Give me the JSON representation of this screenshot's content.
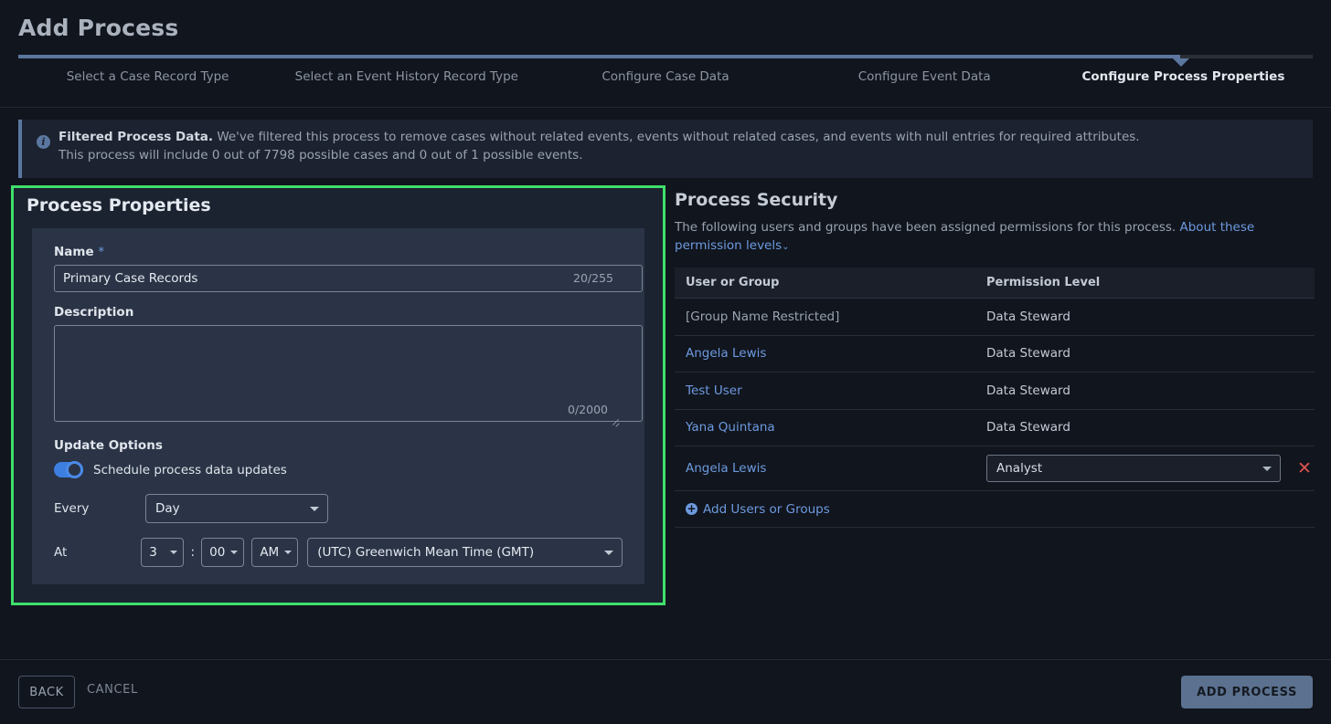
{
  "header": {
    "title": "Add Process",
    "steps": [
      {
        "label": "Select a Case Record Type",
        "active": false
      },
      {
        "label": "Select an Event History Record Type",
        "active": false
      },
      {
        "label": "Configure Case Data",
        "active": false
      },
      {
        "label": "Configure Event Data",
        "active": false
      },
      {
        "label": "Configure Process Properties",
        "active": true
      }
    ],
    "progress_percent": 90
  },
  "banner": {
    "icon": "info-icon",
    "strong": "Filtered Process Data.",
    "line1": " We've filtered this process to remove cases without related events, events without related cases, and events with null entries for required attributes.",
    "line2": "This process will include 0 out of 7798 possible cases and 0 out of 1 possible events."
  },
  "process_properties": {
    "panel_title": "Process Properties",
    "highlight_color": "#3ee06b",
    "name_label": "Name",
    "required_mark": "*",
    "name_value": "Primary Case Records",
    "name_counter": "20/255",
    "description_label": "Description",
    "description_value": "",
    "description_counter": "0/2000",
    "update_options_label": "Update Options",
    "schedule_toggle_label": "Schedule process data updates",
    "schedule_toggle_on": true,
    "every_label": "Every",
    "every_value": "Day",
    "at_label": "At",
    "hour_value": "3",
    "colon": ":",
    "minute_value": "00",
    "ampm_value": "AM",
    "timezone_value": "(UTC) Greenwich Mean Time (GMT)"
  },
  "process_security": {
    "title": "Process Security",
    "description": "The following users and groups have been assigned permissions for this process.",
    "link_text": "About these permission levels",
    "link_chevron": "⌄",
    "columns": [
      "User or Group",
      "Permission Level"
    ],
    "rows": [
      {
        "user": "[Group Name Restricted]",
        "is_link": false,
        "permission": "Data Steward",
        "editable": false
      },
      {
        "user": "Angela Lewis",
        "is_link": true,
        "permission": "Data Steward",
        "editable": false
      },
      {
        "user": "Test User",
        "is_link": true,
        "permission": "Data Steward",
        "editable": false
      },
      {
        "user": "Yana Quintana",
        "is_link": true,
        "permission": "Data Steward",
        "editable": false
      },
      {
        "user": "Angela Lewis",
        "is_link": true,
        "permission": "Analyst",
        "editable": true
      }
    ],
    "add_label": "Add Users or Groups",
    "remove_symbol": "✕"
  },
  "footer": {
    "back_label": "BACK",
    "cancel_label": "CANCEL",
    "submit_label": "ADD PROCESS"
  }
}
